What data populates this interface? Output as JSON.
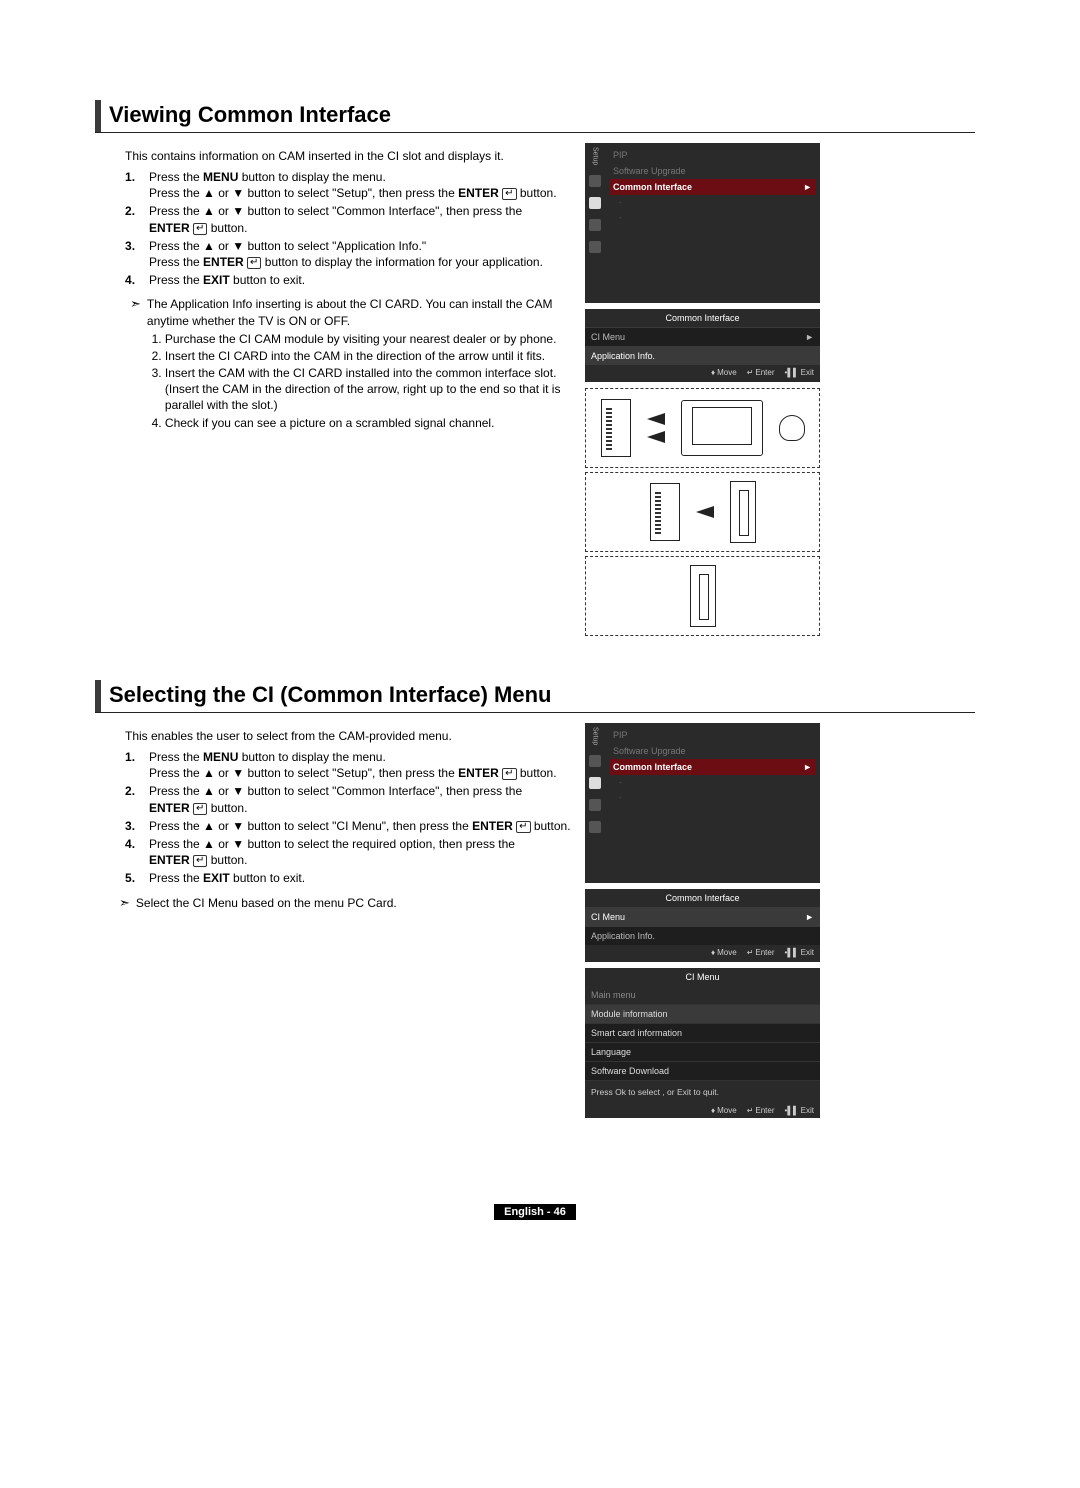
{
  "section1": {
    "heading": "Viewing Common Interface",
    "intro": "This contains information on CAM inserted in the CI slot and displays it.",
    "steps": {
      "s1a": "Press the ",
      "s1b": "MENU",
      "s1c": " button to display the menu.",
      "s1d": "Press the ▲ or ▼ button to select \"Setup\", then press the ",
      "s1e": "ENTER",
      "s1f": " button.",
      "s2a": "Press the ▲ or ▼ button to select \"Common Interface\", then press the ",
      "s2b": "ENTER",
      "s2c": " button.",
      "s3a": "Press the ▲ or ▼ button to select \"Application Info.\"",
      "s3b": "Press the ",
      "s3c": "ENTER",
      "s3d": " button to display the information for your application.",
      "s4a": "Press the ",
      "s4b": "EXIT",
      "s4c": " button to exit."
    },
    "note_lead": "The Application Info inserting is about the CI CARD. You can install the CAM anytime whether the TV is ON or OFF.",
    "note_items": [
      "Purchase the CI CAM module by visiting your nearest dealer or by phone.",
      "Insert the CI CARD into the CAM in the direction of the arrow until it fits.",
      "Insert the CAM with the CI CARD installed into the common interface slot. (Insert the CAM in the direction of the arrow, right up to the end so that it is parallel with the slot.)",
      "Check if you can see a picture on a scrambled signal channel."
    ]
  },
  "section2": {
    "heading": "Selecting the CI (Common Interface) Menu",
    "intro": "This enables the user to select from the CAM-provided menu.",
    "steps": {
      "s1a": "Press the ",
      "s1b": "MENU",
      "s1c": " button to display the menu.",
      "s1d": "Press the ▲ or ▼ button to select \"Setup\", then press the ",
      "s1e": "ENTER",
      "s1f": " button.",
      "s2a": "Press the ▲ or ▼ button to select \"Common Interface\", then press the ",
      "s2b": "ENTER",
      "s2c": " button.",
      "s3a": "Press the ▲ or ▼ button to select \"CI Menu\", then press the ",
      "s3b": "ENTER",
      "s3c": " button.",
      "s4a": "Press the ▲ or ▼ button to select the required option, then press the ",
      "s4b": "ENTER",
      "s4c": " button.",
      "s5a": "Press the ",
      "s5b": "EXIT",
      "s5c": " button to exit."
    },
    "note_lead": "Select the CI Menu based on the menu PC Card."
  },
  "osd_setup": {
    "side_label": "Setup",
    "pip": "PIP",
    "software": "Software Upgrade",
    "ci": "Common Interface",
    "sub1": "-",
    "sub2": "-"
  },
  "osd_ci": {
    "title": "Common Interface",
    "row1": "CI Menu",
    "row2": "Application Info.",
    "footer": {
      "move": "Move",
      "enter": "Enter",
      "exit": "Exit"
    }
  },
  "osd_ci2": {
    "title": "Common Interface",
    "row1": "CI Menu",
    "row2": "Application Info.",
    "footer": {
      "move": "Move",
      "enter": "Enter",
      "exit": "Exit"
    }
  },
  "osd_cimenu": {
    "title": "CI Menu",
    "sub": "Main menu",
    "items": [
      "Module information",
      "Smart card information",
      "Language",
      "Software Download"
    ],
    "hint": "Press Ok to select , or Exit to quit.",
    "footer": {
      "move": "Move",
      "enter": "Enter",
      "exit": "Exit"
    }
  },
  "enter_glyph": "↵",
  "footer": "English - 46"
}
